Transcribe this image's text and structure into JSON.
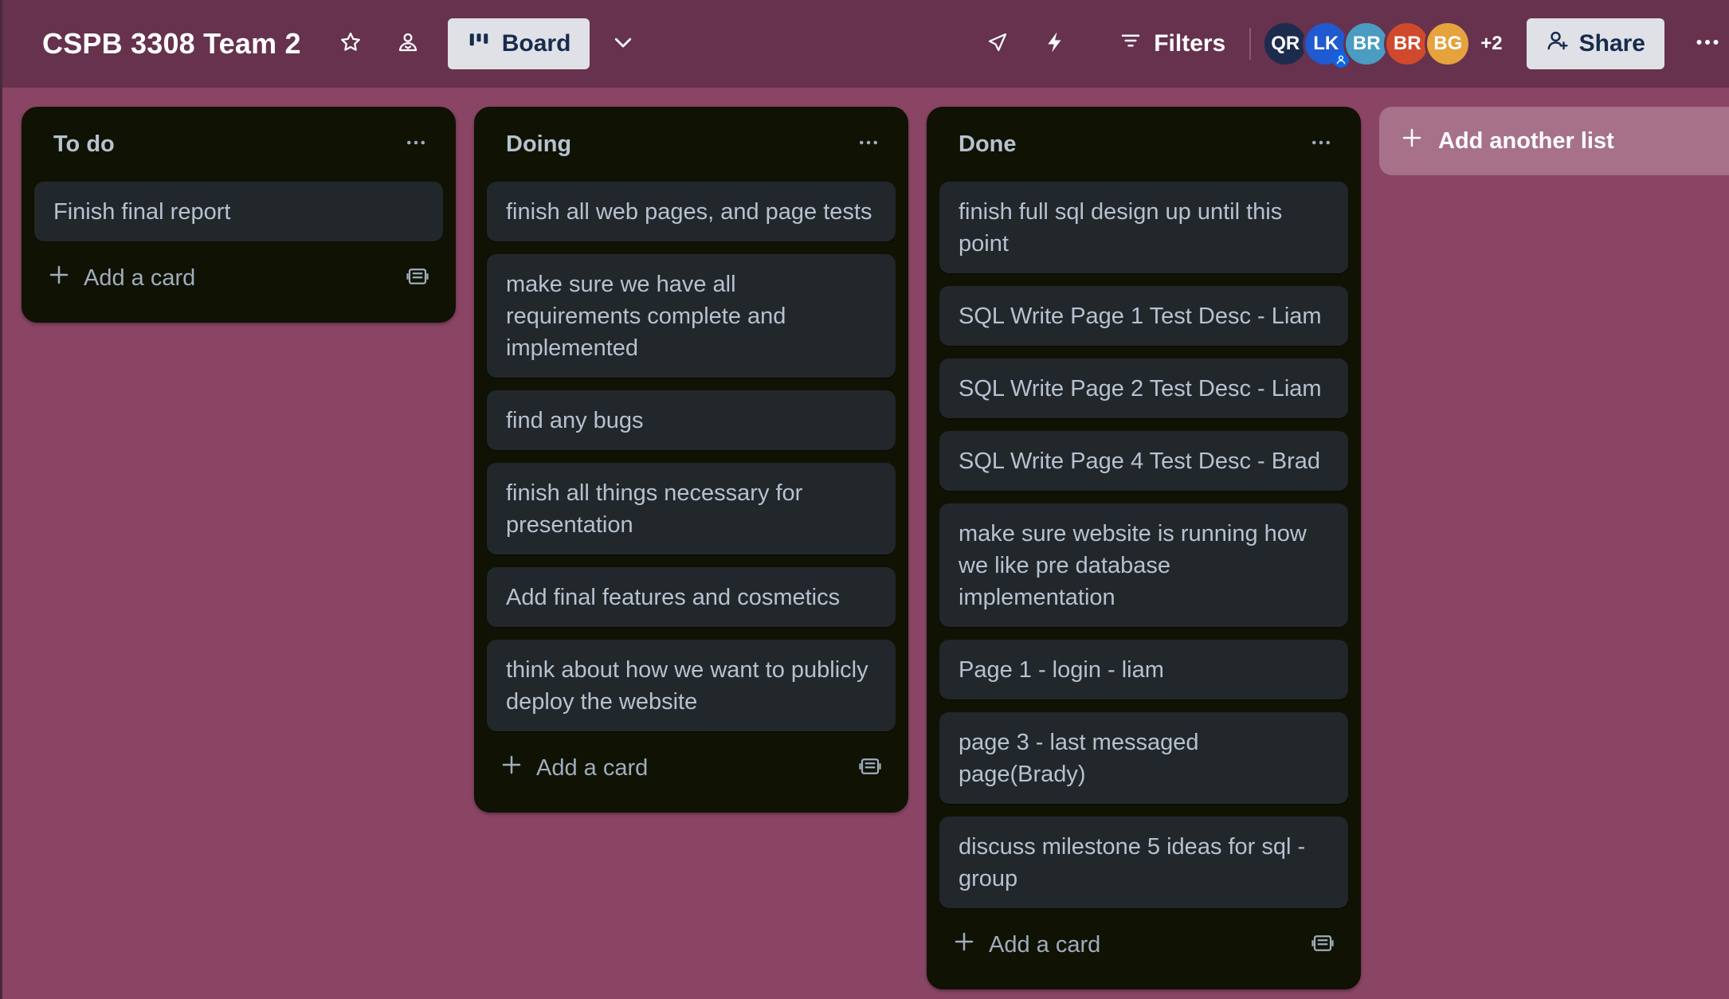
{
  "board": {
    "title": "CSPB 3308 Team 2",
    "view_label": "Board",
    "filters_label": "Filters",
    "share_label": "Share",
    "more_members": "+2",
    "background_color": "#8a4565",
    "header_color": "#66324d"
  },
  "members": [
    {
      "initials": "QR",
      "color": "#1d2b4d"
    },
    {
      "initials": "LK",
      "color": "#1f5ad1"
    },
    {
      "initials": "BR",
      "color": "#4a9cc2"
    },
    {
      "initials": "BR",
      "color": "#d1492c"
    },
    {
      "initials": "BG",
      "color": "#e6a23c"
    }
  ],
  "lists": [
    {
      "title": "To do",
      "add_card_label": "Add a card",
      "cards": [
        "Finish final report"
      ]
    },
    {
      "title": "Doing",
      "add_card_label": "Add a card",
      "cards": [
        "finish all web pages, and page tests",
        "make sure we have all requirements complete and implemented",
        "find any bugs",
        "finish all things necessary for presentation",
        "Add final features and cosmetics",
        "think about how we want to publicly deploy the website"
      ]
    },
    {
      "title": "Done",
      "add_card_label": "Add a card",
      "cards": [
        "finish full sql design up until this point",
        "SQL Write Page 1 Test Desc - Liam",
        "SQL Write Page 2 Test Desc - Liam",
        "SQL Write Page 4 Test Desc - Brad",
        "make sure website is running how we like pre database implementation",
        "Page 1 - login - liam",
        "page 3 - last messaged page(Brady)",
        "discuss milestone 5 ideas for sql - group"
      ]
    }
  ],
  "add_list_label": "Add another list",
  "icons": {
    "star": "star-icon",
    "visibility": "workspace-visible-icon",
    "view": "board-icon",
    "chevron": "chevron-down-icon",
    "power_ups": "rocket-icon",
    "automation": "lightning-icon",
    "filter": "filter-icon",
    "share": "add-member-icon",
    "more": "more-icon",
    "list_menu": "ellipsis-icon",
    "add": "plus-icon",
    "template": "card-template-icon"
  }
}
